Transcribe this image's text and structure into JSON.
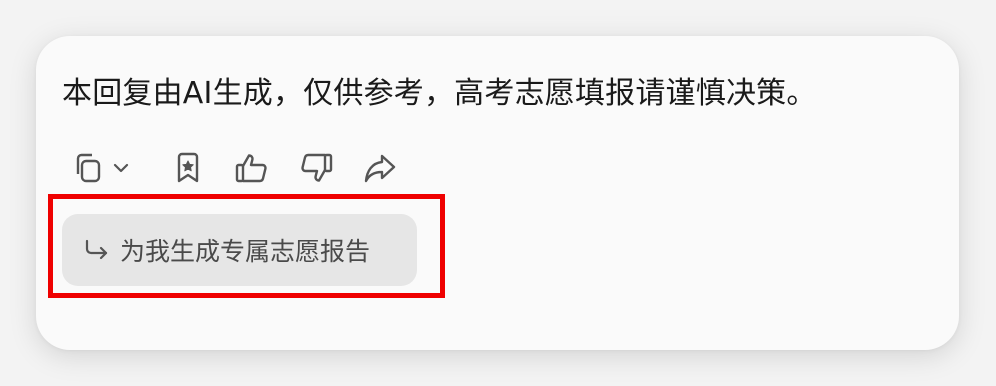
{
  "message": {
    "notice_text": "本回复由AI生成，仅供参考，高考志愿填报请谨慎决策。"
  },
  "toolbar": {
    "icons": [
      "copy-icon",
      "chevron-down-icon",
      "bookmark-star-icon",
      "thumbs-up-icon",
      "thumbs-down-icon",
      "share-icon"
    ]
  },
  "suggestion": {
    "icon": "reply-arrow-icon",
    "label": "为我生成专属志愿报告"
  },
  "colors": {
    "highlight": "#ef0000",
    "card_bg": "#fafafa",
    "chip_bg": "#e6e6e6",
    "icon": "#555555"
  }
}
